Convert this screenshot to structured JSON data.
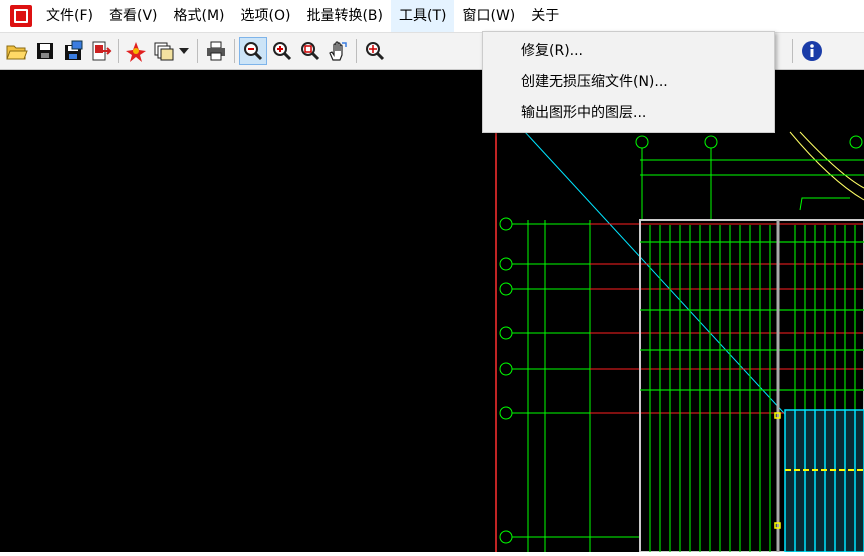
{
  "menubar": {
    "items": [
      "文件(F)",
      "查看(V)",
      "格式(M)",
      "选项(O)",
      "批量转换(B)",
      "工具(T)",
      "窗口(W)",
      "关于"
    ],
    "active_index": 5
  },
  "tools_menu": {
    "items": [
      "修复(R)...",
      "创建无损压缩文件(N)...",
      "输出图形中的图层..."
    ]
  },
  "colors": {
    "canvas_bg": "#000000",
    "toolbar_bg": "#f3f3f3",
    "menu_hover": "#e5f3ff",
    "drawing_green": "#00ff00",
    "drawing_cyan": "#00e5ff",
    "drawing_red": "#ff0000",
    "drawing_yellow": "#ffff00"
  },
  "toolbar": {
    "icons": [
      "open-folder-icon",
      "save-icon",
      "save-as-icon",
      "export-icon",
      "pdf-icon",
      "layers-icon",
      "dropdown-arrow-icon",
      "print-icon",
      "zoom-out-icon",
      "zoom-in-icon",
      "zoom-window-icon",
      "pan-hand-icon",
      "zoom-extents-icon",
      "info-icon"
    ]
  }
}
